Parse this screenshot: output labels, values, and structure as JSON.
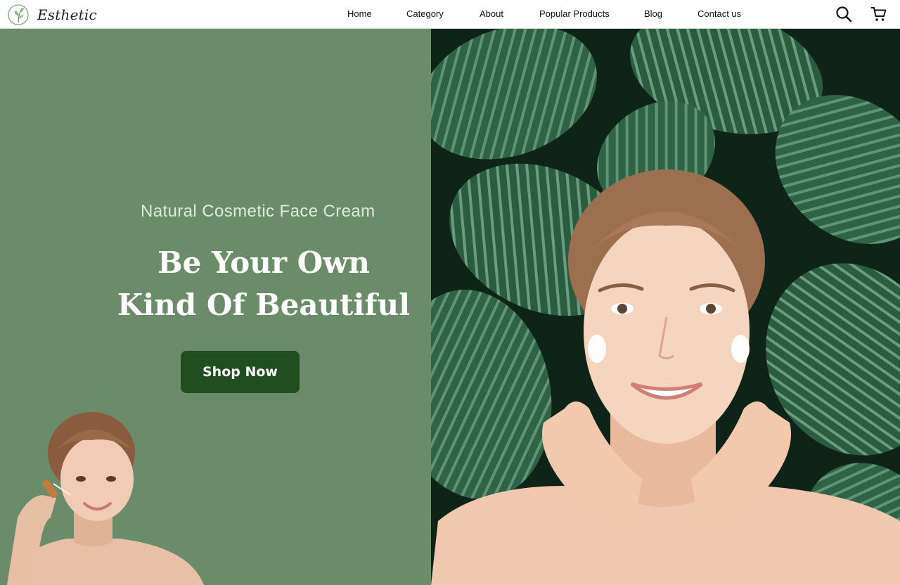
{
  "brand": {
    "name": "Esthetic",
    "logo_icon": "leaf-circle-icon",
    "accent_color": "#1f4f1f",
    "panel_color": "#6a8c69"
  },
  "nav": {
    "items": [
      {
        "label": "Home"
      },
      {
        "label": "Category"
      },
      {
        "label": "About"
      },
      {
        "label": "Popular Products"
      },
      {
        "label": "Blog"
      },
      {
        "label": "Contact us"
      }
    ],
    "icons": [
      "search-icon",
      "cart-icon"
    ]
  },
  "hero": {
    "subtitle": "Natural Cosmetic Face Cream",
    "headline_line1": "Be Your Own",
    "headline_line2": "Kind Of Beautiful",
    "cta_label": "Shop Now"
  }
}
